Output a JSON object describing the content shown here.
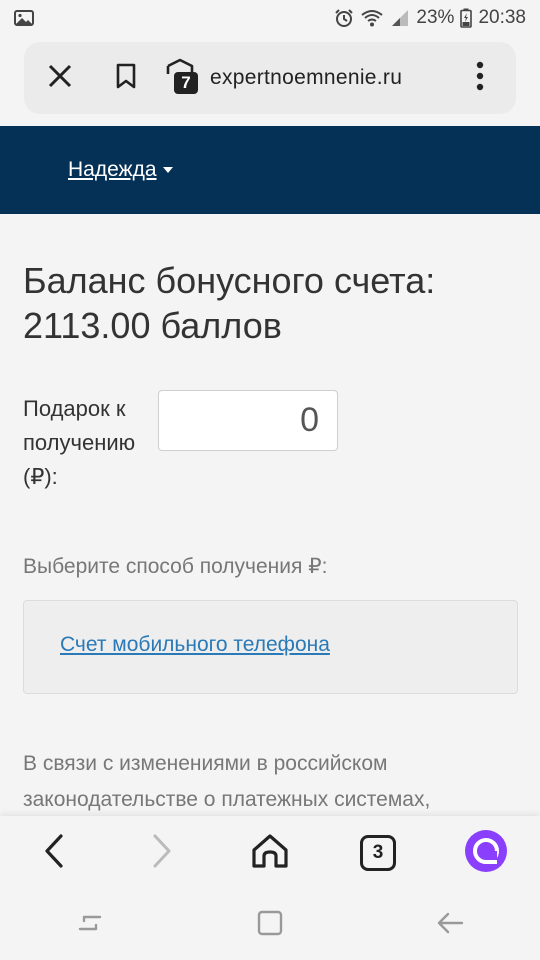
{
  "status_bar": {
    "battery_percent": "23%",
    "time": "20:38",
    "icons": [
      "image-icon",
      "alarm-icon",
      "wifi-icon",
      "signal-icon",
      "battery-icon"
    ]
  },
  "browser": {
    "url": "expertnoemnenie.ru",
    "tabs_badge": "7",
    "icons": [
      "close-icon",
      "bookmark-icon",
      "shield-icon",
      "more-vert-icon"
    ]
  },
  "header": {
    "user_name": "Надежда"
  },
  "content": {
    "balance_line1": "Баланс бонусного счета:",
    "balance_line2": "2113.00 баллов",
    "gift_label": "Подарок к получению (₽):",
    "gift_value": "0",
    "choose_method_label": "Выберите способ получения ₽:",
    "method_link": "Счет мобильного телефона",
    "notice_text": "В связи с изменениями в российском законодательстве о платежных системах,"
  },
  "toolbar": {
    "tabs_count": "3",
    "icons": [
      "back-icon",
      "forward-icon",
      "home-icon",
      "tabs-icon",
      "alice-icon"
    ],
    "alice_color": "#8a3ffc"
  },
  "navigation": {
    "icons": [
      "recent-apps-icon",
      "home-button-icon",
      "back-nav-icon"
    ]
  },
  "colors": {
    "header_bg": "#063156",
    "link": "#2a7ab8",
    "page_bg": "#f4f4f4"
  }
}
